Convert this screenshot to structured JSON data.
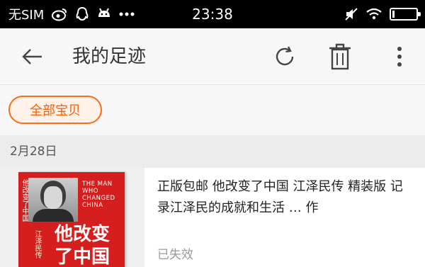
{
  "status_bar": {
    "carrier": "无SIM",
    "time": "23:38",
    "icons": [
      "weibo-icon",
      "qq-icon",
      "android-icon",
      "more-dots-icon",
      "mute-icon",
      "wifi-icon",
      "battery-icon"
    ],
    "battery_level": 0.08
  },
  "toolbar": {
    "title": "我的足迹",
    "icons": [
      "back-arrow-icon",
      "refresh-icon",
      "trash-icon",
      "more-vertical-icon"
    ]
  },
  "filter": {
    "chip_label": "全部宝贝"
  },
  "history": [
    {
      "date": "2月28日",
      "items": [
        {
          "title": "正版包邮 他改变了中国 江泽民传 精装版 记录江泽民的成就和生活 … 作",
          "status": "已失效",
          "thumbnail": {
            "cover_title_cn": "他改变了中国",
            "cover_title_en": "THE MAN WHO CHANGED CHINA",
            "cover_subtitle": "江泽民传"
          }
        }
      ]
    }
  ],
  "colors": {
    "accent": "#ff5a00",
    "chip_bg": "#fff2e8",
    "status_bar_bg": "#000000",
    "book_red": "#d51f1f"
  }
}
